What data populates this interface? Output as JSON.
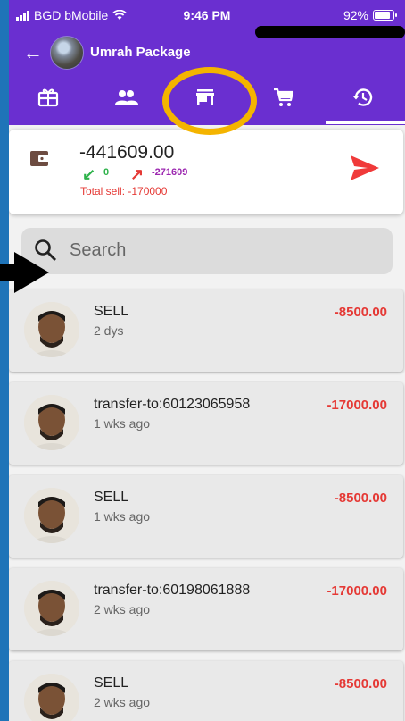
{
  "status_bar": {
    "carrier": "BGD bMobile",
    "time": "9:46 PM",
    "battery": "92%",
    "battery_level": 0.92
  },
  "app_bar": {
    "title": "Umrah Package"
  },
  "tabs": [
    {
      "icon": "gift-box-icon",
      "active": false
    },
    {
      "icon": "people-icon",
      "active": false
    },
    {
      "icon": "store-icon",
      "active": false,
      "highlighted": true
    },
    {
      "icon": "cart-icon",
      "active": false
    },
    {
      "icon": "history-icon",
      "active": true
    }
  ],
  "balance": {
    "amount": "-441609.00",
    "in_value": "0",
    "out_value": "-271609",
    "total_sell": "Total sell: -170000"
  },
  "search": {
    "placeholder": "Search"
  },
  "transactions": [
    {
      "title": "SELL",
      "time": "2 dys",
      "amount": "-8500.00"
    },
    {
      "title": "transfer-to:60123065958",
      "time": "1 wks ago",
      "amount": "-17000.00"
    },
    {
      "title": "SELL",
      "time": "1 wks ago",
      "amount": "-8500.00"
    },
    {
      "title": "transfer-to:60198061888",
      "time": "2 wks ago",
      "amount": "-17000.00"
    },
    {
      "title": "SELL",
      "time": "2 wks ago",
      "amount": "-8500.00"
    }
  ],
  "colors": {
    "header": "#6a2fd0",
    "negative": "#e53935",
    "positive": "#2db24a",
    "highlight": "#f4b400",
    "frame": "#1f74b8"
  }
}
